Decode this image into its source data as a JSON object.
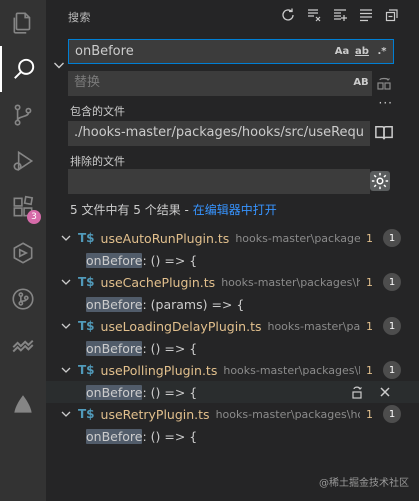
{
  "activity": {
    "items": [
      {
        "name": "explorer-icon"
      },
      {
        "name": "search-icon",
        "active": true
      },
      {
        "name": "source-control-icon"
      },
      {
        "name": "run-debug-icon"
      },
      {
        "name": "extensions-icon",
        "badge": "3"
      },
      {
        "name": "remote-icon"
      },
      {
        "name": "git-graph-icon"
      },
      {
        "name": "live-share-icon"
      },
      {
        "name": "bookmark-icon"
      }
    ]
  },
  "header": {
    "title": "搜索",
    "actions": [
      "refresh-icon",
      "clear-results-icon",
      "new-search-editor-icon",
      "view-as-list-icon",
      "collapse-all-icon"
    ]
  },
  "search": {
    "value": "onBefore",
    "options": {
      "match_case": "Aa",
      "whole_word": "ab",
      "regex": ".*"
    }
  },
  "replace": {
    "placeholder": "替换",
    "preserve_case": "AB"
  },
  "include": {
    "label": "包含的文件",
    "value": "./hooks-master/packages/hooks/src/useRequest/...",
    "more": "···"
  },
  "exclude": {
    "label": "排除的文件",
    "value": ""
  },
  "summary": {
    "text": "5 文件中有 5 个结果 - ",
    "link": "在编辑器中打开"
  },
  "results": [
    {
      "icon": "T$",
      "file": "useAutoRunPlugin.ts",
      "path": "hooks-master\\packages\\hooks\\src\\useRequest",
      "count": "1",
      "badge": "1",
      "match": "onBefore",
      "rest": ": () => {"
    },
    {
      "icon": "T$",
      "file": "useCachePlugin.ts",
      "path": "hooks-master\\packages\\hooks\\src\\useRequest",
      "count": "1",
      "badge": "1",
      "match": "onBefore",
      "rest": ": (params) => {"
    },
    {
      "icon": "T$",
      "file": "useLoadingDelayPlugin.ts",
      "path": "hooks-master\\packages\\hooks\\src",
      "count": "1",
      "badge": "1",
      "match": "onBefore",
      "rest": ": () => {"
    },
    {
      "icon": "T$",
      "file": "usePollingPlugin.ts",
      "path": "hooks-master\\packages\\hooks\\src\\useRequest",
      "count": "1",
      "badge": "1",
      "match": "onBefore",
      "rest": ": () => {",
      "hovered": true
    },
    {
      "icon": "T$",
      "file": "useRetryPlugin.ts",
      "path": "hooks-master\\packages\\hooks\\src\\useRequest",
      "count": "1",
      "badge": "1",
      "match": "onBefore",
      "rest": ": () => {"
    }
  ],
  "watermark": "@稀土掘金技术社区",
  "colors": {
    "accent": "#007fd4",
    "link": "#3794ff",
    "file": "#e2c08d",
    "ts": "#519aba",
    "badge": "#d66ba9"
  }
}
